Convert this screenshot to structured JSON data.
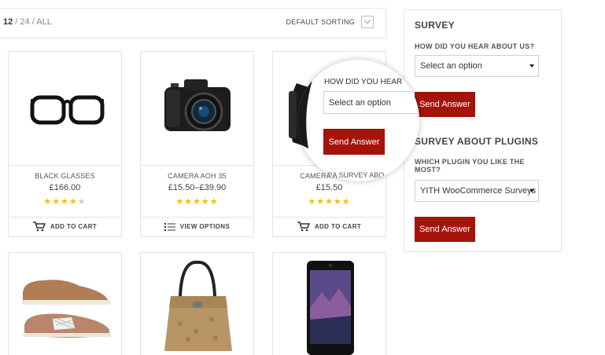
{
  "toolbar": {
    "per_page_active": "12",
    "per_page_sep1": " / ",
    "per_page_opt2": "24",
    "per_page_sep2": " / ",
    "per_page_opt3": "ALL",
    "sorting_label": "DEFAULT SORTING"
  },
  "products": [
    {
      "name": "BLACK GLASSES",
      "price": "£166.00",
      "rating": 4,
      "action": "ADD TO CART",
      "action_icon": "cart-icon"
    },
    {
      "name": "CAMERA AOH 35",
      "price": "£15.50–£39.90",
      "rating": 5,
      "action": "VIEW OPTIONS",
      "action_icon": "list-icon"
    },
    {
      "name": "CAMERA AOH 36",
      "price": "£15.50",
      "rating": 5,
      "action": "ADD TO CART",
      "action_icon": "cart-icon"
    },
    {
      "name": "",
      "price": ""
    },
    {
      "name": "",
      "price": ""
    },
    {
      "name": "",
      "price": ""
    }
  ],
  "survey": {
    "title": "SURVEY",
    "question1": "HOW DID YOU HEAR ABOUT US?",
    "select1_value": "Select an option",
    "button_label": "Send Answer",
    "title2": "SURVEY ABOUT PLUGINS",
    "question2": "WHICH PLUGIN YOU LIKE THE MOST?",
    "select2_value": "YITH WooCommerce Surveys",
    "button2_label": "Send Answer"
  },
  "magnifier": {
    "question": "HOW DID YOU HEAR",
    "select_value": "Select an option",
    "button_label": "Send Answer",
    "under_text": "CAMERA SURVEY ABO"
  },
  "colors": {
    "accent": "#a5140b",
    "star": "#f2c200",
    "border": "#e4e4e4"
  }
}
